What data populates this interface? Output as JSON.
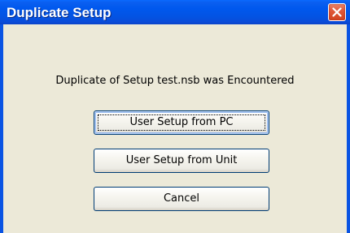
{
  "dialog": {
    "title": "Duplicate Setup",
    "message": "Duplicate of Setup test.nsb was Encountered",
    "close_icon": "close-icon",
    "buttons": {
      "pc_label": "User Setup from PC",
      "unit_label": "User Setup from Unit",
      "cancel_label": "Cancel"
    }
  },
  "colors": {
    "titlebar": "#0058ee",
    "client": "#ece9d8",
    "close": "#e0593a"
  }
}
